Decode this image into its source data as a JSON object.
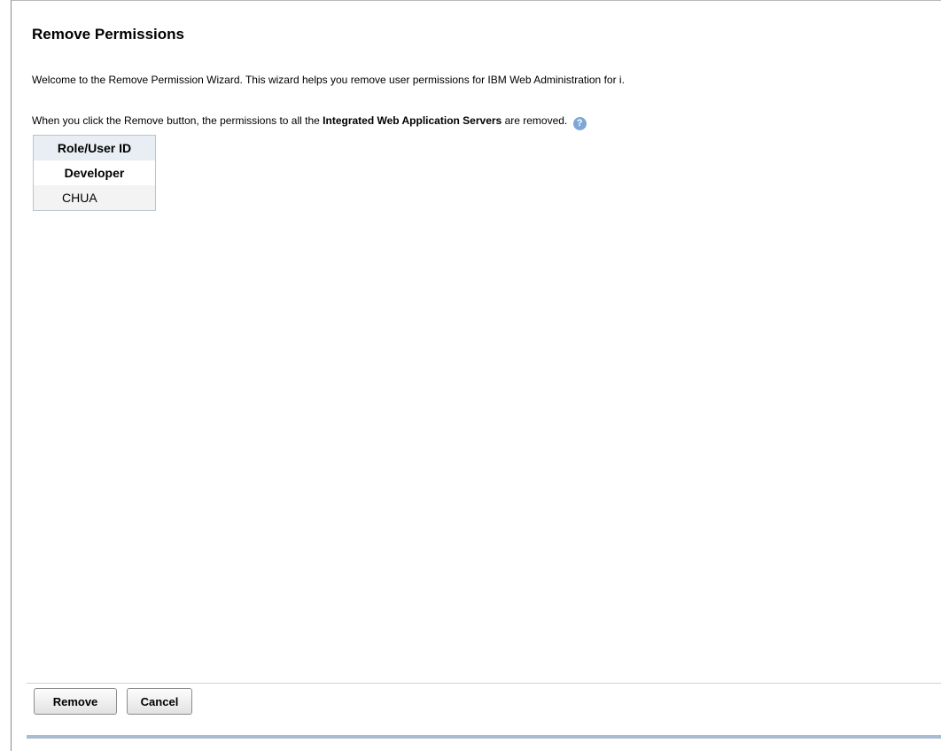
{
  "page": {
    "title": "Remove Permissions",
    "intro": "Welcome to the Remove Permission Wizard. This wizard helps you remove user permissions for IBM Web Administration for i.",
    "notice_prefix": "When you click the Remove button, the permissions to all the ",
    "notice_bold": "Integrated Web Application Servers",
    "notice_suffix": " are removed.",
    "help_icon": "help-icon",
    "help_glyph": "?"
  },
  "table": {
    "header": "Role/User ID",
    "role": "Developer",
    "user": "CHUA"
  },
  "buttons": {
    "remove": "Remove",
    "cancel": "Cancel"
  },
  "colors": {
    "help_icon": "#7fa7d6",
    "table_header_bg": "#e9eef4",
    "bottom_bar": "#a9bbd1"
  }
}
